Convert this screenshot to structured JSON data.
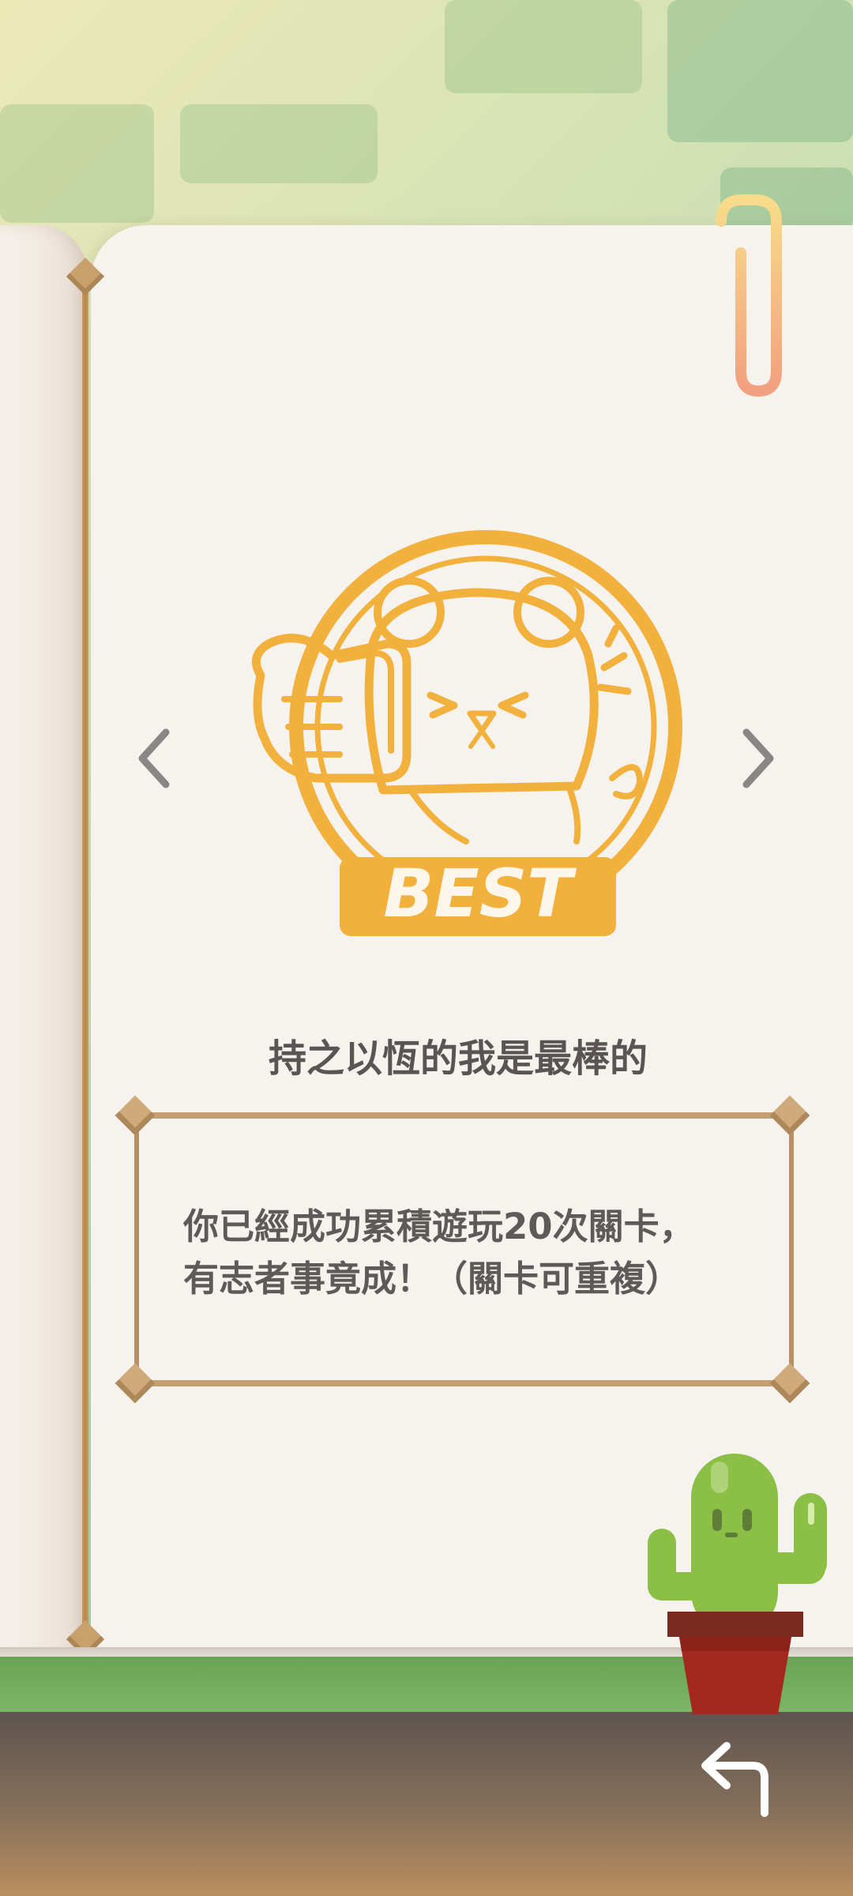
{
  "achievement": {
    "badge_text": "BEST",
    "title": "持之以恆的我是最棒的",
    "description_lines": [
      "你已經成功累積遊玩20次關卡，",
      "有志者事竟成！（關卡可重複）"
    ]
  },
  "icons": {
    "prev": "chevron-left-icon",
    "next": "chevron-right-icon",
    "back": "return-arrow-icon",
    "clip": "paperclip-icon",
    "mascot": "cactus-icon",
    "badge": "bear-thumbs-up-stamp"
  },
  "colors": {
    "badge": "#f2b13d",
    "text": "#5a5553",
    "frame": "#b99063",
    "page": "#f6f3ef",
    "cactus": "#8bbf45",
    "pot": "#a3281d"
  }
}
